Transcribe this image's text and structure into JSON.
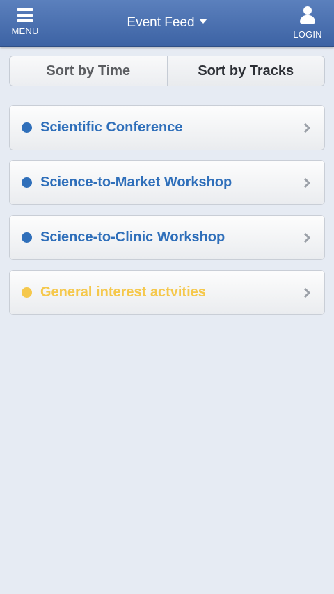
{
  "header": {
    "menu_label": "MENU",
    "title": "Event Feed",
    "login_label": "LOGIN"
  },
  "sort": {
    "by_time": "Sort by Time",
    "by_tracks": "Sort by Tracks",
    "selected": "Sort by Tracks"
  },
  "tracks": [
    {
      "label": "Scientific Conference",
      "color": "#2f6fba"
    },
    {
      "label": "Science-to-Market Workshop",
      "color": "#2f6fba"
    },
    {
      "label": "Science-to-Clinic Workshop",
      "color": "#2f6fba"
    },
    {
      "label": "General interest actvities",
      "color": "#f5c84c"
    }
  ],
  "icons": {
    "menu": "hamburger-menu-icon",
    "title_dropdown": "caret-down-icon",
    "login": "user-icon",
    "row_arrow": "chevron-right-icon"
  }
}
